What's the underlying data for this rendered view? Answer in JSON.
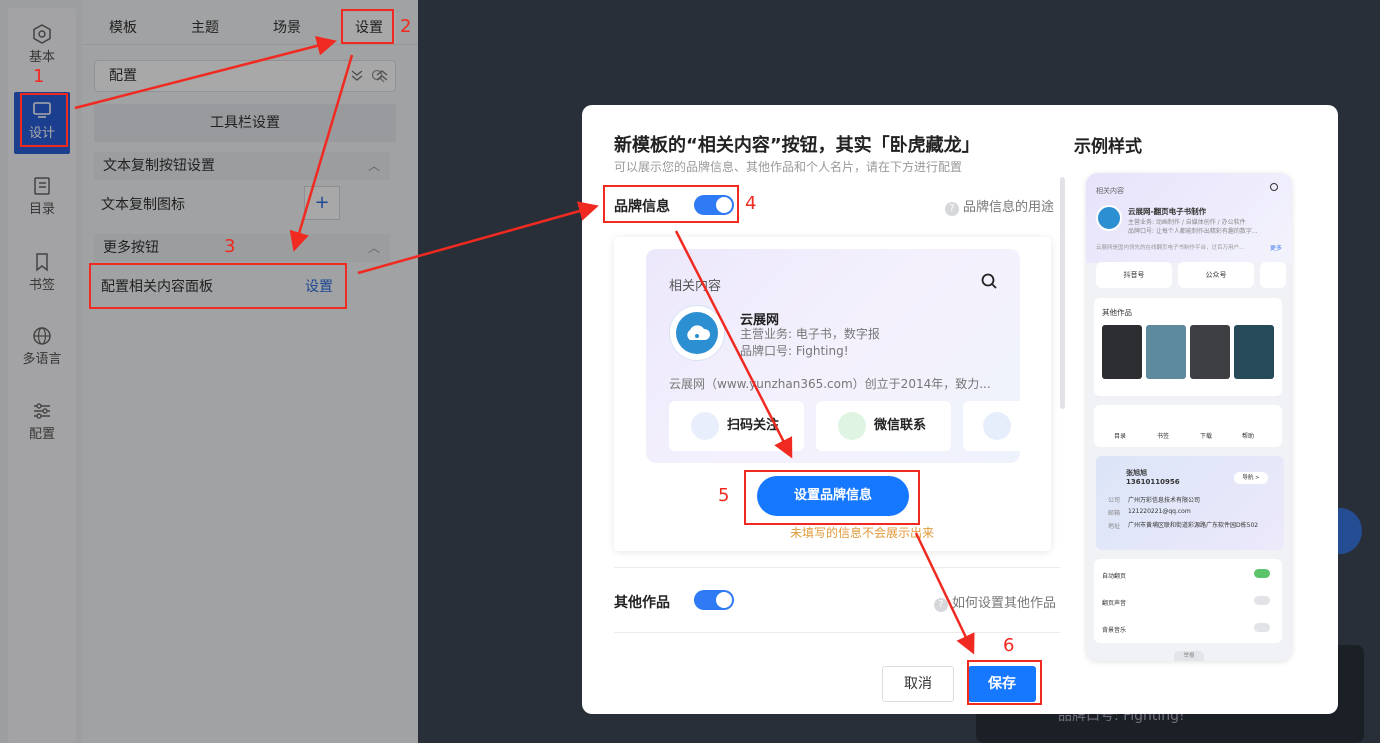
{
  "sidebar": {
    "items": [
      {
        "label": "基本",
        "icon": "hexagon-icon"
      },
      {
        "label": "设计",
        "icon": "monitor-icon",
        "active": true
      },
      {
        "label": "目录",
        "icon": "catalog-icon"
      },
      {
        "label": "书签",
        "icon": "bookmark-icon"
      },
      {
        "label": "多语言",
        "icon": "globe-icon"
      },
      {
        "label": "配置",
        "icon": "sliders-icon"
      }
    ]
  },
  "panel": {
    "tabs": [
      "模板",
      "主题",
      "场景",
      "设置"
    ],
    "search_value": "配置",
    "toolbar_settings": "工具栏设置",
    "text_copy_section": "文本复制按钮设置",
    "text_copy_icon_label": "文本复制图标",
    "more_buttons_section": "更多按钮",
    "related_panel_label": "配置相关内容面板",
    "related_panel_link": "设置"
  },
  "modal": {
    "title": "新模板的“相关内容”按钮，其实「卧虎藏龙」",
    "subtitle": "可以展示您的品牌信息、其他作品和个人名片，请在下方进行配置",
    "brand_label": "品牌信息",
    "brand_enabled": true,
    "brand_help": "品牌信息的用途",
    "card": {
      "header": "相关内容",
      "name": "云展网",
      "business": "主营业务: 电子书，数字报",
      "slogan": "品牌口号: Fighting!",
      "desc": "云展网（www.yunzhan365.com）创立于2014年，致力...",
      "buttons": [
        "扫码关注",
        "微信联系"
      ]
    },
    "set_brand_button": "设置品牌信息",
    "note": "未填写的信息不会展示出来",
    "works_label": "其他作品",
    "works_enabled": true,
    "works_help": "如何设置其他作品",
    "cancel": "取消",
    "save": "保存",
    "example_title": "示例样式",
    "preview": {
      "header": "相关内容",
      "brand_name": "云展网-翻页电子书制作",
      "brand_line1": "主营业务: 动画制作 / 自媒体创作 / 办公软件",
      "brand_line2": "品牌口号: 让每个人都能制作出精彩有趣的数字...",
      "brand_desc": "云展网是国内领先的在线翻页电子书制作平台，过百万用户...",
      "more": "更多",
      "chips": [
        "抖音号",
        "公众号"
      ],
      "works_title": "其他作品",
      "nav": [
        "目录",
        "书签",
        "下载",
        "帮助"
      ],
      "contact_name": "张旭旭",
      "contact_phone": "13610110956",
      "contact_nav": "导航 >",
      "company_label": "公司",
      "company": "广州万彩信息技术有限公司",
      "email_label": "邮箱",
      "email": "121220221@qq.com",
      "address_label": "地址",
      "address": "广州市黄埔区联和街道彩源路广东软件园D栋502",
      "settings": [
        "自动翻页",
        "翻页声音",
        "背景音乐"
      ],
      "settings_on": [
        true,
        false,
        false
      ],
      "footer": "举报"
    }
  },
  "annotations": [
    "1",
    "2",
    "3",
    "4",
    "5",
    "6"
  ],
  "background_toast": "品牌口号: Fighting!",
  "colors": {
    "accent": "#1677ff",
    "annotation": "#f02a20",
    "active_nav": "#2b5fd9"
  }
}
